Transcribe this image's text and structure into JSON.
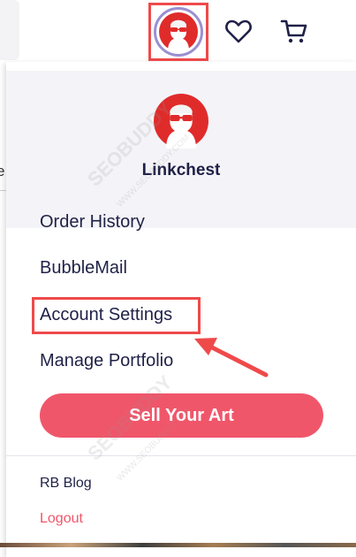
{
  "header": {
    "avatar_icon": "user-avatar-icon",
    "wishlist_icon": "heart-icon",
    "cart_icon": "cart-icon",
    "colors": {
      "highlight": "#ef4a4a",
      "avatar_ring": "#9b8fd1"
    }
  },
  "page": {
    "left_letter": "e"
  },
  "dropdown": {
    "username": "Linkchest",
    "menu": [
      {
        "label": "Order History"
      },
      {
        "label": "BubbleMail"
      },
      {
        "label": "Account Settings"
      },
      {
        "label": "Manage Portfolio"
      }
    ],
    "sell_button": "Sell Your Art",
    "footer": [
      {
        "label": "RB Blog"
      },
      {
        "label": "Logout"
      }
    ],
    "colors": {
      "accent": "#f0566a",
      "text": "#1f2147",
      "logout": "#f0566a"
    }
  },
  "watermark": {
    "brand": "SEOBUDDY",
    "site": "WWW.SEOBUDDY.COM"
  }
}
